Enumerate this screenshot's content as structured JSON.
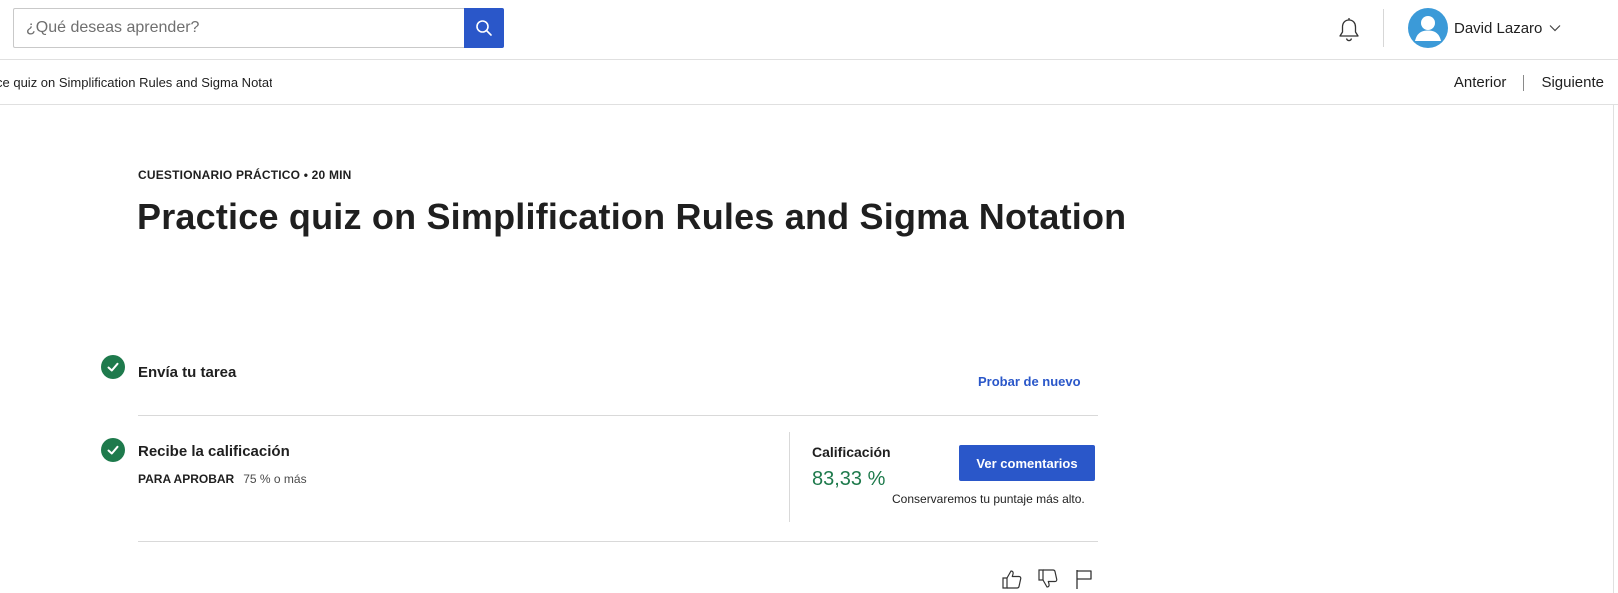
{
  "header": {
    "search": {
      "placeholder": "¿Qué deseas aprender?",
      "value": ""
    },
    "search_button_icon": "search-icon",
    "notifications_icon": "bell-icon",
    "user": {
      "name": "David Lazaro",
      "avatar_icon": "user-avatar-icon",
      "menu_icon": "chevron-down-icon"
    }
  },
  "subheader": {
    "breadcrumb": "ce quiz on Simplification Rules and Sigma Notati",
    "prev_label": "Anterior",
    "next_label": "Siguiente"
  },
  "main": {
    "eyebrow": "CUESTIONARIO PRÁCTICO • 20 MIN",
    "title": "Practice quiz on Simplification Rules and Sigma Notation",
    "steps": [
      {
        "label": "Envía tu tarea",
        "status_icon": "check-circle-icon",
        "action_label": "Probar de nuevo"
      },
      {
        "label": "Recibe la calificación",
        "status_icon": "check-circle-icon"
      }
    ],
    "pass": {
      "key": "PARA APROBAR",
      "value": "75 % o más"
    },
    "grade": {
      "label": "Calificación",
      "value": "83,33 %",
      "feedback_button": "Ver comentarios",
      "note": "Conservaremos tu puntaje más alto."
    },
    "feedback_actions": [
      "thumbs-up-icon",
      "thumbs-down-icon",
      "flag-icon"
    ]
  },
  "colors": {
    "primary": "#2a57c9",
    "success": "#1e7a4c",
    "avatar": "#3b9ad8",
    "border": "#e0e0e0"
  }
}
